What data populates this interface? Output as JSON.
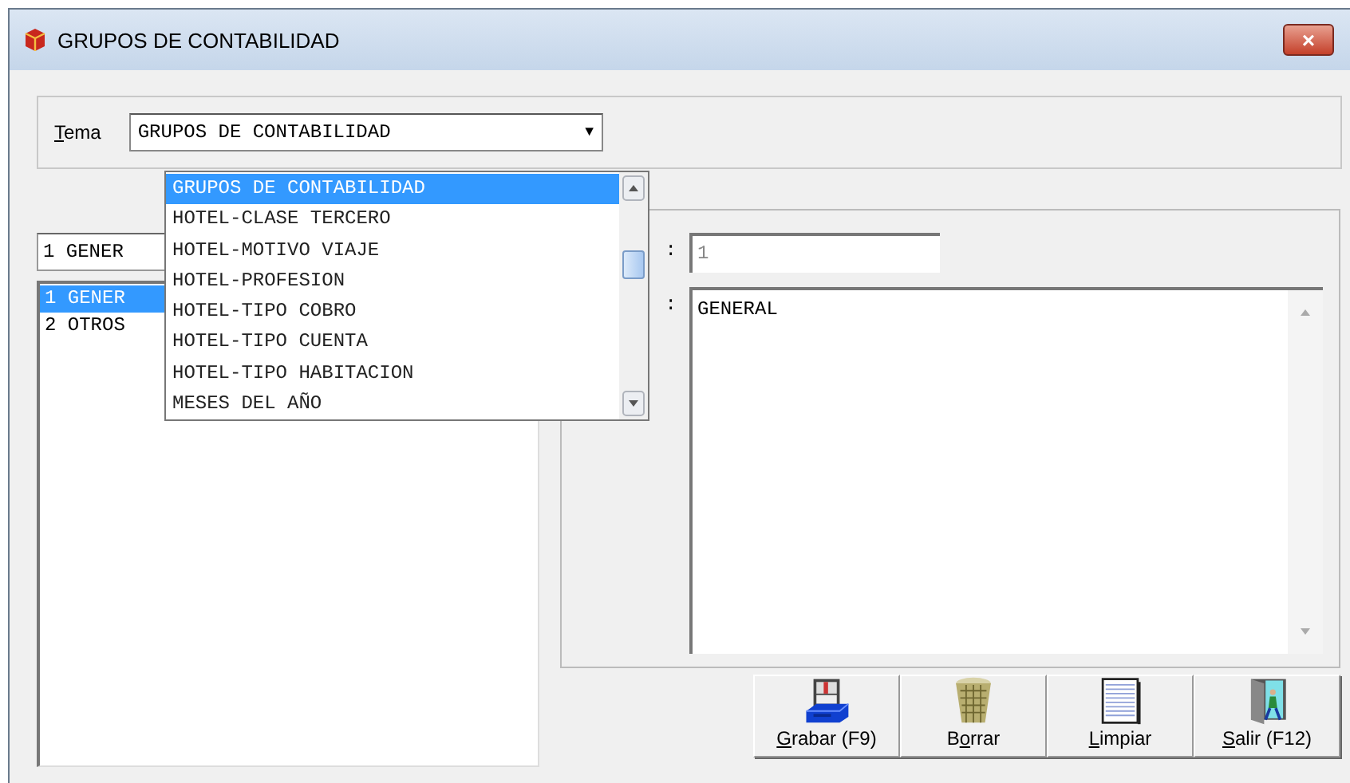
{
  "window": {
    "title": "GRUPOS DE CONTABILIDAD",
    "close": "×"
  },
  "tema": {
    "label_key": "T",
    "label_after": "ema",
    "value": "GRUPOS DE CONTABILIDAD",
    "arrow": "▼",
    "options": [
      {
        "label": "GRUPOS DE CONTABILIDAD",
        "selected": true
      },
      {
        "label": "HOTEL-CLASE TERCERO",
        "selected": false
      },
      {
        "label": "HOTEL-MOTIVO VIAJE",
        "selected": false
      },
      {
        "label": "HOTEL-PROFESION",
        "selected": false
      },
      {
        "label": "HOTEL-TIPO COBRO",
        "selected": false
      },
      {
        "label": "HOTEL-TIPO CUENTA",
        "selected": false
      },
      {
        "label": "HOTEL-TIPO HABITACION",
        "selected": false
      },
      {
        "label": "MESES DEL AÑO",
        "selected": false
      }
    ]
  },
  "search": {
    "value": "1 GENER"
  },
  "list": [
    {
      "label": "1 GENER",
      "selected": true
    },
    {
      "label": "2 OTROS",
      "selected": false
    }
  ],
  "detail": {
    "code_label": ":",
    "code": "1",
    "name_label": ":",
    "name": "GENERAL"
  },
  "buttons": [
    {
      "kind": "save",
      "label_key": "G",
      "label_after": "rabar (F9)"
    },
    {
      "kind": "delete",
      "label_before": "B",
      "label_key": "o",
      "label_after": "rrar"
    },
    {
      "kind": "clear",
      "label_key": "L",
      "label_after": "impiar"
    },
    {
      "kind": "exit",
      "label_key": "S",
      "label_after": "alir (F12)"
    }
  ]
}
